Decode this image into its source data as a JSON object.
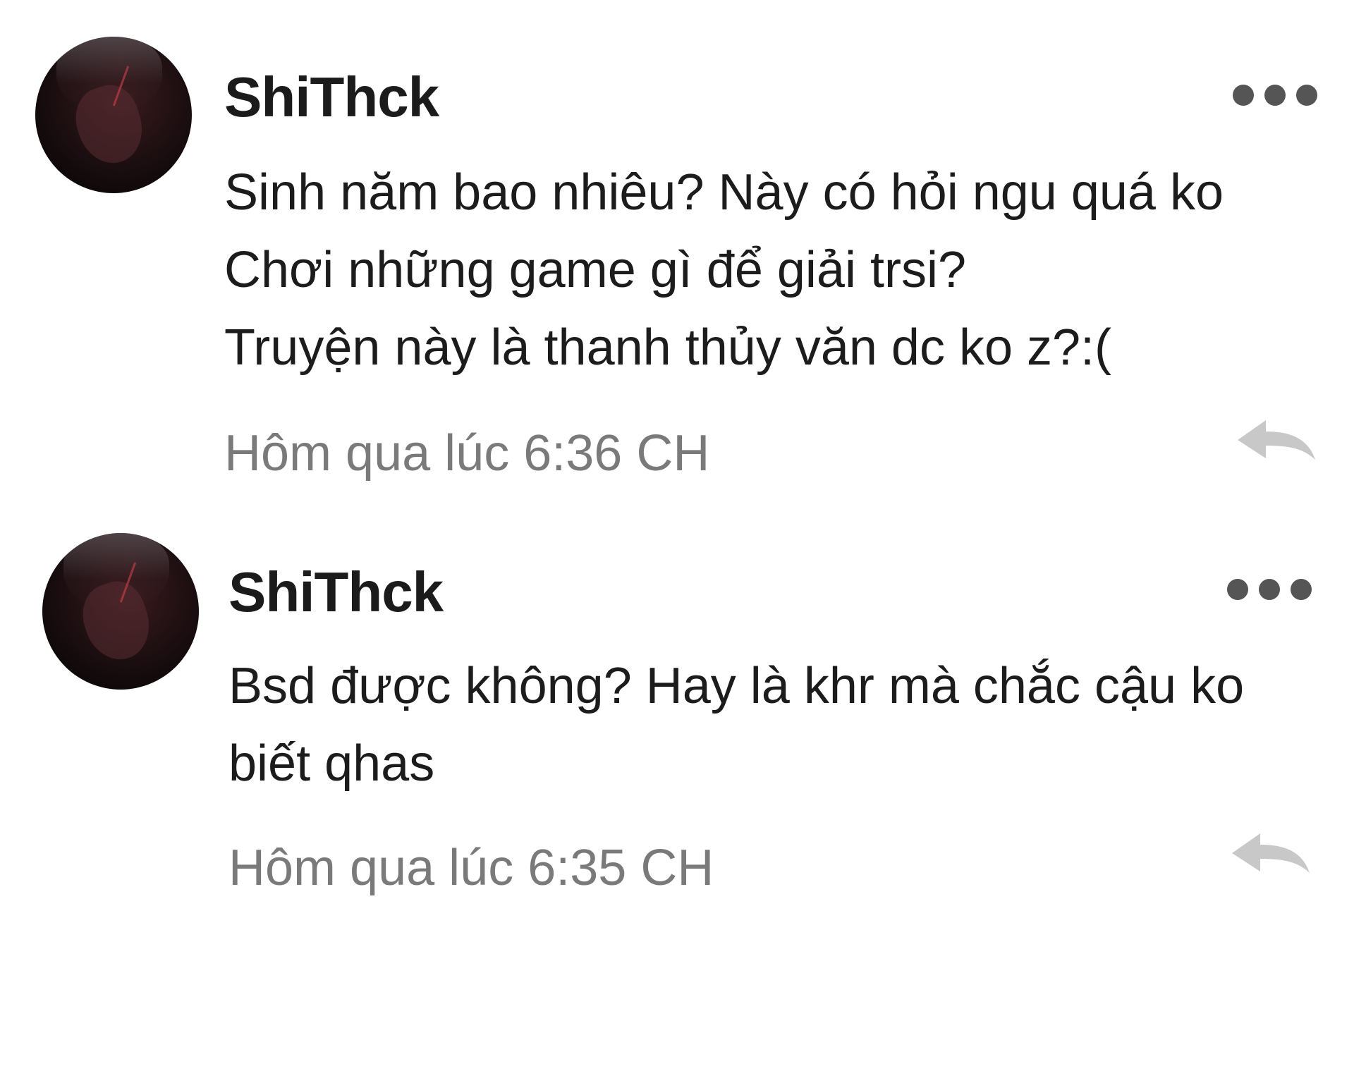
{
  "comments": [
    {
      "username": "ShiThck",
      "more_icon": "more-horizontal-icon",
      "lines": [
        "Sinh năm bao nhiêu? Này có hỏi ngu quá ko",
        "Chơi những game gì để giải trsi?",
        "Truyện này là thanh thủy văn dc ko z?:("
      ],
      "timestamp": "Hôm qua lúc 6:36 CH",
      "reply_icon": "reply-icon"
    },
    {
      "username": "ShiThck",
      "more_icon": "more-horizontal-icon",
      "lines": [
        "Bsd được không? Hay là khr mà chắc cậu ko",
        "biết qhas"
      ],
      "timestamp": "Hôm qua lúc 6:35 CH",
      "reply_icon": "reply-icon"
    }
  ],
  "colors": {
    "text": "#1c1c1c",
    "muted": "#7a7a7a",
    "icon": "#555555",
    "reply_icon": "#c8c8c8",
    "background": "#ffffff"
  }
}
